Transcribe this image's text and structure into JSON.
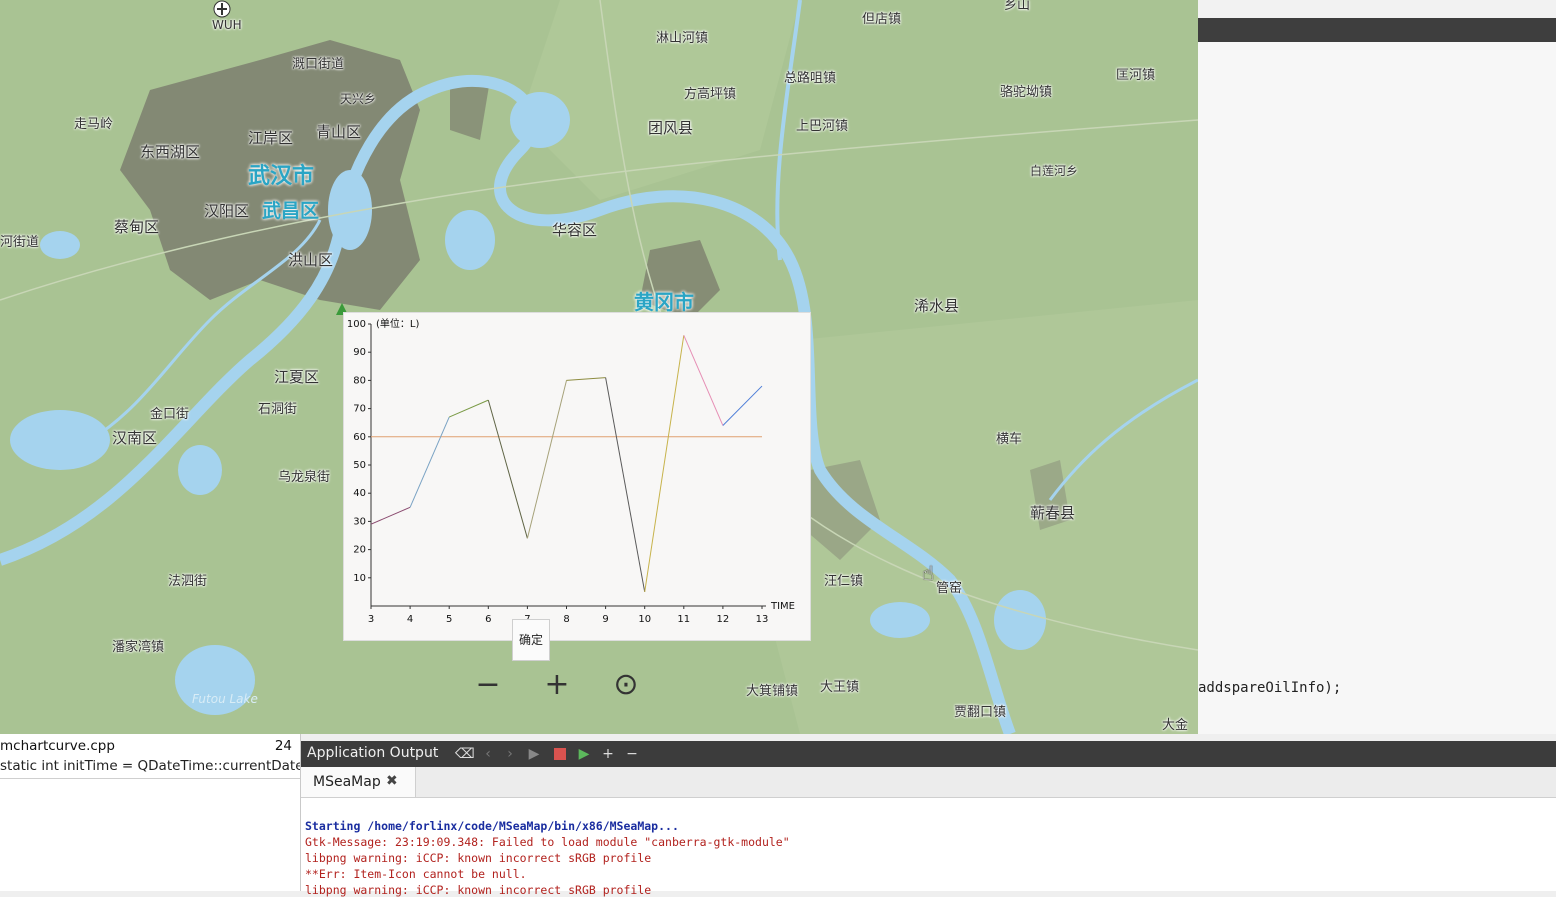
{
  "map": {
    "airport_code": "WUH",
    "labels": {
      "wuhan": "武汉市",
      "wuchang": "武昌区",
      "jiangan": "江岸区",
      "qingshan": "青山区",
      "dongxihu": "东西湖区",
      "hanyang": "汉阳区",
      "caidian": "蔡甸区",
      "hongshan": "洪山区",
      "jiangxia": "江夏区",
      "shidong": "石洞街",
      "hannan": "汉南区",
      "jinkou": "金口街",
      "wulongquan": "乌龙泉街",
      "fasi": "法泗街",
      "panjiawan": "潘家湾镇",
      "zoumaling": "走马岭",
      "hejiedao": "河街道",
      "xinkou": "溉口街道",
      "tianxingxiang": "天兴乡",
      "linshanhe": "淋山河镇",
      "fanggao": "方高坪镇",
      "zonglu": "总路咀镇",
      "shangbalu": "上巴河镇",
      "tuanfeng": "团风县",
      "huarong": "华容区",
      "huanggang": "黄冈市",
      "danhe": "但店镇",
      "xishui": "浠水县",
      "luotuo": "骆驼坳镇",
      "kuanghe": "匡河镇",
      "bailianhe": "白莲河乡",
      "hengche": "横车",
      "qichun": "蕲春县",
      "guanyao": "管窑",
      "wangren": "汪仁镇",
      "daji": "大箕铺镇",
      "dawang": "大王镇",
      "caohe": "贾翻口镇",
      "dajin": "大金",
      "shaoshan": "乡山"
    },
    "controls": {
      "zoom_out": "−",
      "zoom_in": "+",
      "locate": "⊙"
    },
    "lake_watermark": "Futou Lake"
  },
  "chart_data": {
    "type": "line",
    "title": "",
    "ylabel": "(单位：L)",
    "xlabel": "TIME",
    "x": [
      3,
      4,
      5,
      6,
      7,
      8,
      9,
      10,
      11,
      12,
      13
    ],
    "y": [
      29,
      35,
      67,
      73,
      24,
      80,
      81,
      5,
      96,
      64,
      78
    ],
    "reference_line": 60,
    "ylim": [
      0,
      100
    ],
    "yticks": [
      10,
      20,
      30,
      40,
      50,
      60,
      70,
      80,
      90,
      100
    ],
    "xlim": [
      3,
      13
    ],
    "segment_colors": [
      "#8a4a6f",
      "#7aa3c4",
      "#7a9a45",
      "#5f6445",
      "#a6a27a",
      "#8d8c40",
      "#5a5a5a",
      "#c7b34b",
      "#e68fb5",
      "#4f7fd8"
    ],
    "reference_color": "#e0a070",
    "grid": false
  },
  "dialog": {
    "ok_label": "确定"
  },
  "ide": {
    "editor_code_line": "addspareOilInfo);",
    "left_file": "mchartcurve.cpp",
    "left_line": "24",
    "left_code": "static int initTime = QDateTime::currentDateT",
    "output_title": "Application Output",
    "tab_label": "MSeaMap",
    "output_lines": [
      "Starting /home/forlinx/code/MSeaMap/bin/x86/MSeaMap...",
      "Gtk-Message: 23:19:09.348: Failed to load module \"canberra-gtk-module\"",
      "libpng warning: iCCP: known incorrect sRGB profile",
      "**Err: Item-Icon cannot be null.",
      "libpng warning: iCCP: known incorrect sRGB profile"
    ]
  }
}
